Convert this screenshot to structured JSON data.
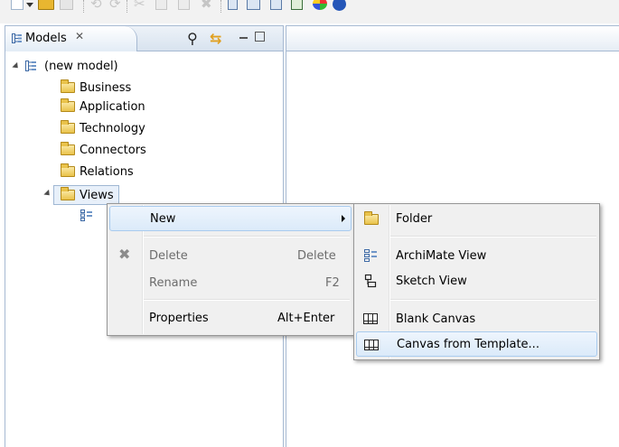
{
  "toolbar": {
    "icons": [
      "new-icon",
      "dropdown-arrow-icon",
      "open-folder-icon",
      "save-icon",
      "undo-icon",
      "redo-icon",
      "cut-icon",
      "copy-icon",
      "paste-icon",
      "delete-icon",
      "model-tree-icon",
      "view-icon",
      "archimate-view-icon",
      "sketch-view-icon",
      "palette-icon",
      "info-icon"
    ]
  },
  "models_view": {
    "tab_label": "Models",
    "tab_close": "✕",
    "tree": {
      "root": "(new model)",
      "folders": [
        "Business",
        "Application",
        "Technology",
        "Connectors",
        "Relations",
        "Views"
      ]
    }
  },
  "context_menu": {
    "new": "New",
    "delete": "Delete",
    "delete_shortcut": "Delete",
    "rename": "Rename",
    "rename_shortcut": "F2",
    "properties": "Properties",
    "properties_shortcut": "Alt+Enter"
  },
  "submenu": {
    "folder": "Folder",
    "archimate_view": "ArchiMate View",
    "sketch_view": "Sketch View",
    "blank_canvas": "Blank Canvas",
    "canvas_from_template": "Canvas from Template..."
  },
  "colors": {
    "accent_border": "#a6b9d2",
    "menu_background": "#f0f0f0",
    "highlight": "#dbeaf9",
    "disabled_text": "#6d6d6d"
  }
}
